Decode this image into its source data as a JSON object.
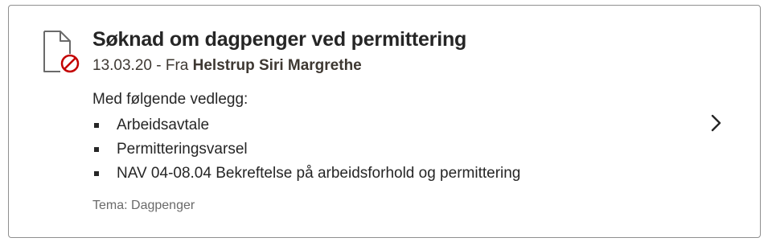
{
  "card": {
    "title": "Søknad om dagpenger ved permittering",
    "date": "13.03.20",
    "from_prefix": " - Fra ",
    "sender": "Helstrup Siri Margrethe",
    "attachments_heading": "Med følgende vedlegg:",
    "attachments": [
      "Arbeidsavtale",
      "Permitteringsvarsel",
      "NAV 04-08.04 Bekreftelse på arbeidsforhold og permittering"
    ],
    "tema": "Tema: Dagpenger"
  },
  "icons": {
    "status_icon": "document-unavailable-icon",
    "chevron_icon": "chevron-right-icon"
  },
  "colors": {
    "status_red": "#c30000",
    "icon_gray": "#6a6a6a",
    "border": "#8f8f8f"
  }
}
